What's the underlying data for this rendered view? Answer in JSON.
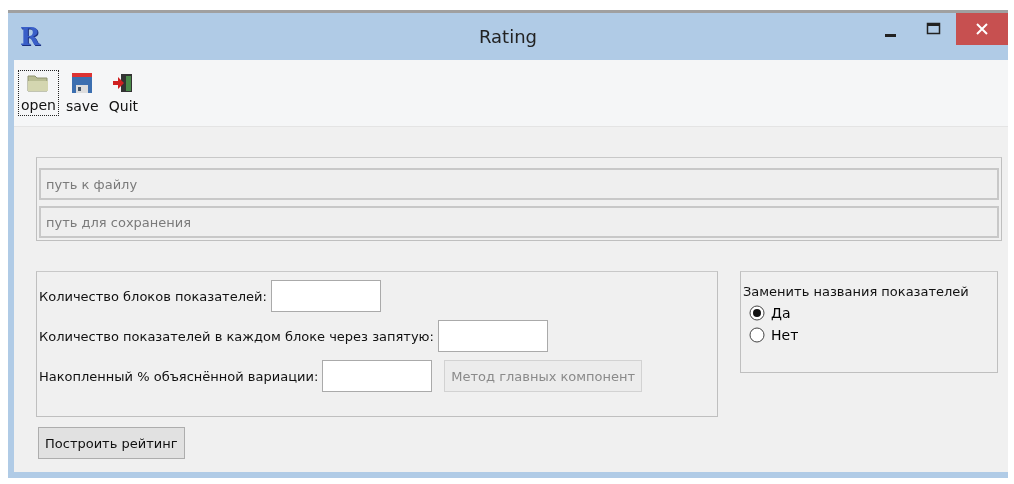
{
  "window": {
    "title": "Rating",
    "app_icon": "R"
  },
  "toolbar": [
    {
      "label": "open",
      "kind": "open",
      "focused": true
    },
    {
      "label": "save",
      "kind": "save",
      "focused": false
    },
    {
      "label": "Quit",
      "kind": "quit",
      "focused": false
    }
  ],
  "paths": [
    {
      "placeholder": "путь к файлу",
      "disabled": true
    },
    {
      "placeholder": "путь для сохранения",
      "disabled": true
    }
  ],
  "params": [
    {
      "label": "Количество блоков показателей:"
    },
    {
      "label": "Количество показателей в каждом блоке через запятую:"
    },
    {
      "label": "Накопленный % объяснённой вариации:",
      "button": {
        "label": "Метод главных компонент",
        "disabled": true
      }
    }
  ],
  "rename": {
    "title": "Заменить названия показателей",
    "options": [
      {
        "label": "Да",
        "selected": true
      },
      {
        "label": "Нет",
        "selected": false
      }
    ]
  },
  "build_button": {
    "label": "Построить рейтинг",
    "disabled": false
  }
}
